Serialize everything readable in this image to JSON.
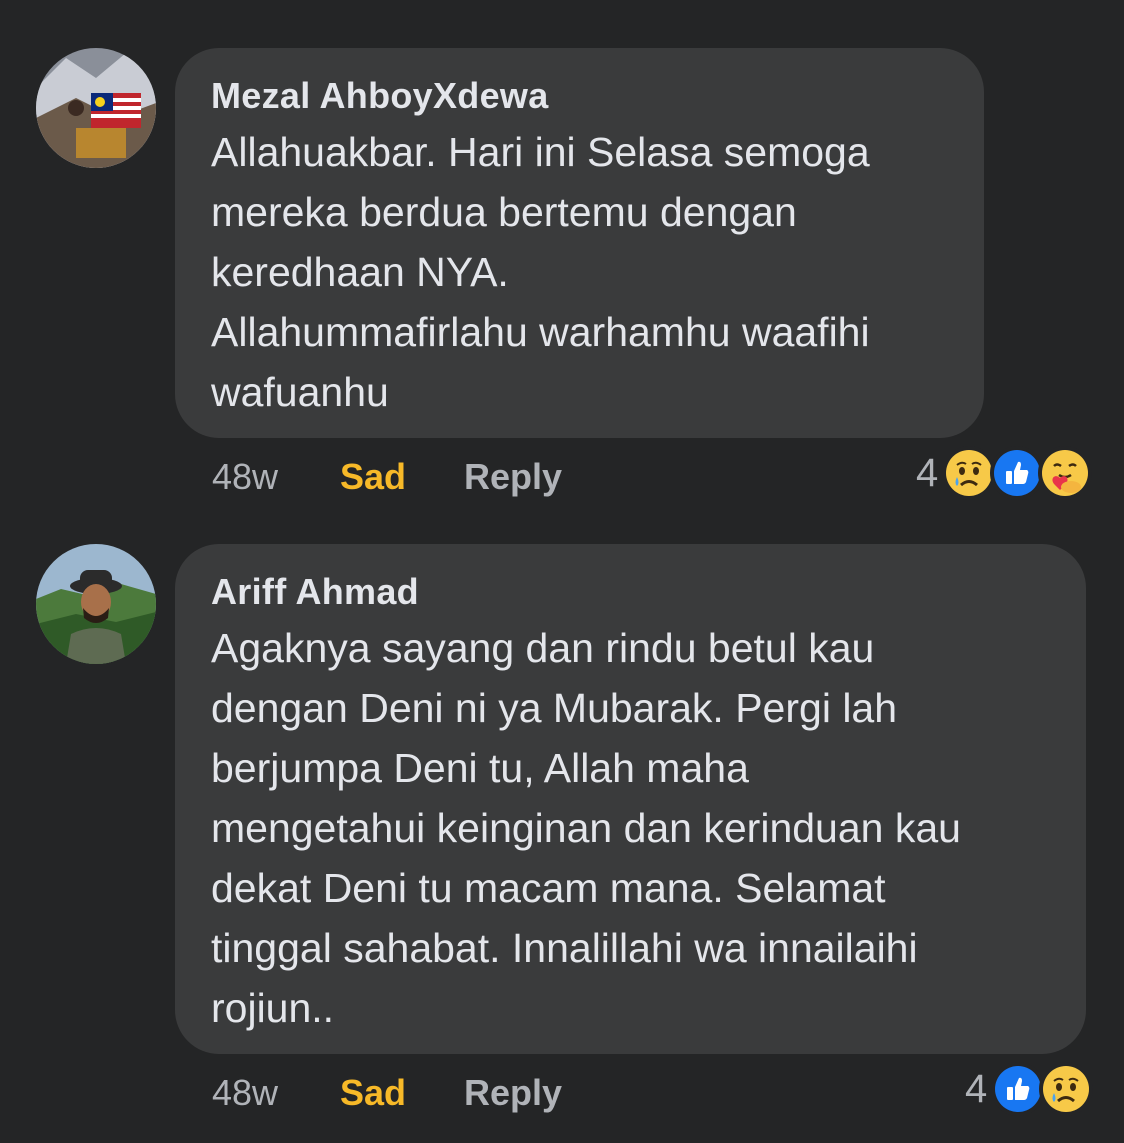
{
  "comments": [
    {
      "author": "Mezal AhboyXdewa",
      "text": "Allahuakbar. Hari ini Selasa semoga\nmereka berdua bertemu dengan\nkeredhaan NYA.\nAllahummafirlahu warhamhu waafihi\nwafuanhu",
      "time": "48w",
      "reaction_label": "Sad",
      "reply_label": "Reply",
      "reaction_count": "4",
      "reactions": [
        "sad-icon",
        "like-icon",
        "care-icon"
      ]
    },
    {
      "author": "Ariff Ahmad",
      "text": "Agaknya sayang dan rindu betul kau\ndengan Deni ni ya Mubarak. Pergi lah\nberjumpa Deni tu, Allah maha\nmengetahui keinginan dan kerinduan kau\ndekat Deni tu macam mana. Selamat\ntinggal sahabat.  Innalillahi wa innailaihi\nrojiun..",
      "time": "48w",
      "reaction_label": "Sad",
      "reply_label": "Reply",
      "reaction_count": "4",
      "reactions": [
        "like-icon",
        "sad-icon"
      ]
    }
  ],
  "colors": {
    "background": "#242526",
    "bubble": "#3a3b3c",
    "sad_label": "#f7b928",
    "muted": "#b0b3b8",
    "like_blue": "#1877f2"
  }
}
